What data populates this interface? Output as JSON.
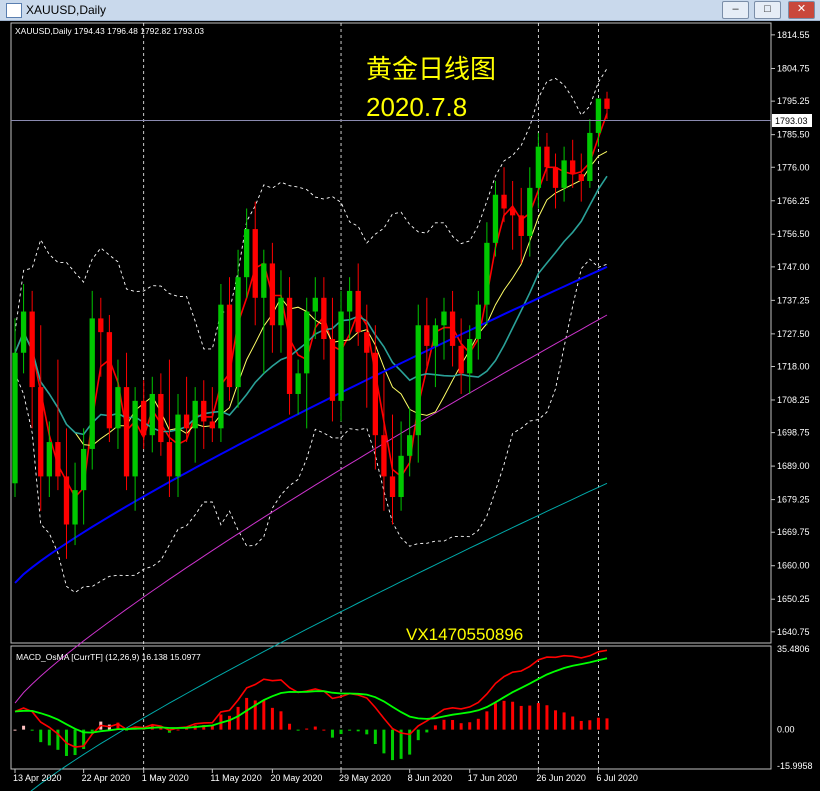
{
  "window": {
    "title": "XAUUSD,Daily",
    "min_glyph": "–",
    "max_glyph": "□",
    "close_glyph": "✕"
  },
  "colors": {
    "bg": "#000000",
    "bull": "#00c800",
    "bear": "#ff0000",
    "grid": "#ffffff",
    "ma_fast": "#ff0000",
    "ma_mid": "#ffff66",
    "ma_slow": "#2aa198",
    "ma_blue": "#0000ff",
    "ma_magenta": "#cc33cc",
    "ma_cyan": "#00aaaa",
    "band": "#ffffff",
    "macd": "#ff0000",
    "signal": "#00ff00",
    "hist_pos": "#ff0000",
    "hist_neg": "#00cc00",
    "hist_fade": "#ffc0c0"
  },
  "chart_header": "XAUUSD,Daily  1794.43 1796.48 1792.82 1793.03",
  "annotation": {
    "title": "黄金日线图",
    "date": "2020.7.8",
    "watermark": "VX1470550896"
  },
  "chart_data": {
    "type": "candlestick",
    "symbol": "XAUUSD",
    "timeframe": "Daily",
    "ohlc_current": [
      1794.43,
      1796.48,
      1792.82,
      1793.03
    ],
    "price_labels": [
      "1814.55",
      "1804.75",
      "1795.25",
      "1785.50",
      "1776.00",
      "1766.25",
      "1756.50",
      "1747.00",
      "1737.25",
      "1727.50",
      "1718.00",
      "1708.25",
      "1698.75",
      "1689.00",
      "1679.25",
      "1669.75",
      "1660.00",
      "1650.25",
      "1640.75"
    ],
    "current_price": "1793.03",
    "y_range": [
      1637.5,
      1818.0
    ],
    "x_labels": [
      "13 Apr 2020",
      "22 Apr 2020",
      "1 May 2020",
      "11 May 2020",
      "20 May 2020",
      "29 May 2020",
      "8 Jun 2020",
      "17 Jun 2020",
      "26 Jun 2020",
      "6 Jul 2020"
    ],
    "candles": [
      [
        1684,
        1732,
        1680,
        1722
      ],
      [
        1722,
        1742,
        1716,
        1734
      ],
      [
        1734,
        1740,
        1700,
        1712
      ],
      [
        1712,
        1730,
        1676,
        1686
      ],
      [
        1686,
        1702,
        1680,
        1696
      ],
      [
        1696,
        1720,
        1682,
        1686
      ],
      [
        1686,
        1700,
        1662,
        1672
      ],
      [
        1672,
        1690,
        1666,
        1682
      ],
      [
        1682,
        1700,
        1672,
        1694
      ],
      [
        1694,
        1740,
        1688,
        1732
      ],
      [
        1732,
        1738,
        1715,
        1728
      ],
      [
        1728,
        1733,
        1696,
        1700
      ],
      [
        1700,
        1720,
        1694,
        1712
      ],
      [
        1712,
        1722,
        1682,
        1686
      ],
      [
        1686,
        1712,
        1676,
        1708
      ],
      [
        1708,
        1714,
        1694,
        1698
      ],
      [
        1698,
        1715,
        1693,
        1710
      ],
      [
        1710,
        1716,
        1692,
        1696
      ],
      [
        1696,
        1720,
        1680,
        1686
      ],
      [
        1686,
        1710,
        1680,
        1704
      ],
      [
        1704,
        1715,
        1696,
        1700
      ],
      [
        1700,
        1712,
        1690,
        1708
      ],
      [
        1708,
        1714,
        1694,
        1702
      ],
      [
        1702,
        1712,
        1696,
        1700
      ],
      [
        1700,
        1742,
        1696,
        1736
      ],
      [
        1736,
        1744,
        1708,
        1712
      ],
      [
        1712,
        1752,
        1706,
        1744
      ],
      [
        1744,
        1764,
        1738,
        1758
      ],
      [
        1758,
        1766,
        1730,
        1738
      ],
      [
        1738,
        1752,
        1716,
        1748
      ],
      [
        1748,
        1754,
        1722,
        1730
      ],
      [
        1730,
        1746,
        1722,
        1738
      ],
      [
        1738,
        1744,
        1704,
        1710
      ],
      [
        1710,
        1720,
        1704,
        1716
      ],
      [
        1716,
        1738,
        1700,
        1734
      ],
      [
        1734,
        1744,
        1726,
        1738
      ],
      [
        1738,
        1744,
        1720,
        1726
      ],
      [
        1726,
        1738,
        1702,
        1708
      ],
      [
        1708,
        1740,
        1702,
        1734
      ],
      [
        1734,
        1744,
        1726,
        1740
      ],
      [
        1740,
        1748,
        1724,
        1728
      ],
      [
        1728,
        1736,
        1706,
        1722
      ],
      [
        1722,
        1730,
        1688,
        1698
      ],
      [
        1698,
        1716,
        1676,
        1686
      ],
      [
        1686,
        1704,
        1672,
        1680
      ],
      [
        1680,
        1702,
        1676,
        1692
      ],
      [
        1692,
        1706,
        1686,
        1698
      ],
      [
        1698,
        1736,
        1690,
        1730
      ],
      [
        1730,
        1738,
        1718,
        1724
      ],
      [
        1724,
        1732,
        1712,
        1730
      ],
      [
        1730,
        1738,
        1720,
        1734
      ],
      [
        1734,
        1740,
        1718,
        1724
      ],
      [
        1724,
        1732,
        1710,
        1716
      ],
      [
        1716,
        1730,
        1710,
        1726
      ],
      [
        1726,
        1740,
        1720,
        1736
      ],
      [
        1736,
        1760,
        1730,
        1754
      ],
      [
        1754,
        1772,
        1750,
        1768
      ],
      [
        1768,
        1776,
        1760,
        1764
      ],
      [
        1764,
        1772,
        1752,
        1762
      ],
      [
        1762,
        1770,
        1748,
        1756
      ],
      [
        1756,
        1776,
        1750,
        1770
      ],
      [
        1770,
        1786,
        1764,
        1782
      ],
      [
        1782,
        1786,
        1772,
        1776
      ],
      [
        1776,
        1780,
        1764,
        1770
      ],
      [
        1770,
        1782,
        1766,
        1778
      ],
      [
        1778,
        1784,
        1770,
        1774
      ],
      [
        1774,
        1780,
        1766,
        1772
      ],
      [
        1772,
        1790,
        1770,
        1786
      ],
      [
        1786,
        1796,
        1782,
        1796
      ],
      [
        1796,
        1798,
        1790,
        1793
      ]
    ],
    "macd_indicator": {
      "name": "MACD_OsMA [CurrTF] (12,26,9)",
      "values": [
        16.138,
        15.0977
      ],
      "scale_labels": [
        "35.4806",
        "0.00",
        "-15.9958"
      ],
      "y_range": [
        -16.0,
        35.48
      ]
    }
  }
}
